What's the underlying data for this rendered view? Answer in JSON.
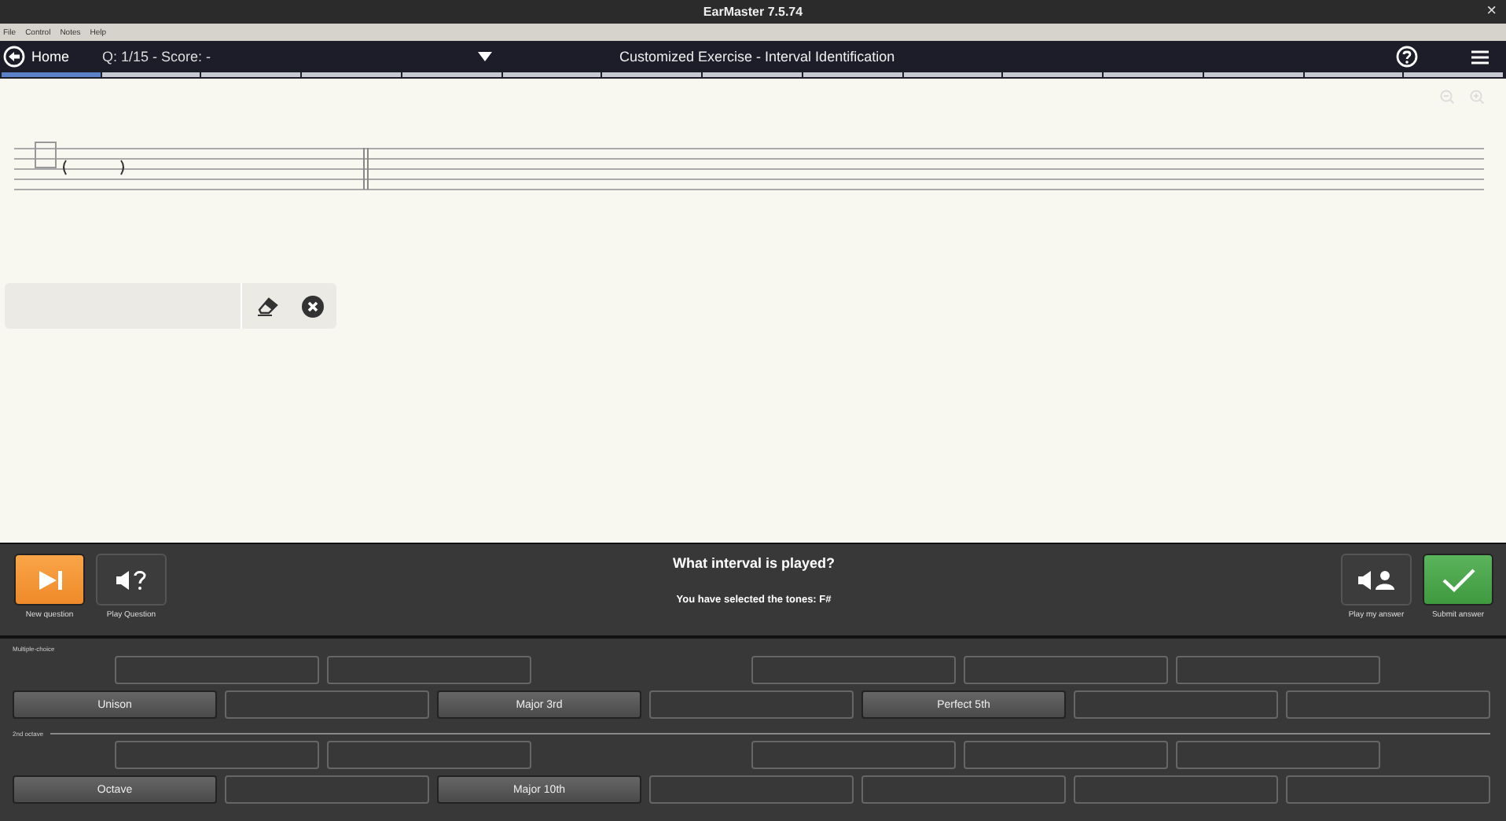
{
  "window": {
    "title": "EarMaster 7.5.74",
    "close": "×"
  },
  "menu": [
    "File",
    "Control",
    "Notes",
    "Help"
  ],
  "toolbar": {
    "home": "Home",
    "status": "Q: 1/15 - Score: -",
    "title": "Customized Exercise - Interval Identification"
  },
  "progress": [
    {
      "selected": true
    },
    {
      "selected": false
    },
    {
      "selected": false
    },
    {
      "selected": false
    },
    {
      "selected": false
    },
    {
      "selected": false
    },
    {
      "selected": false
    },
    {
      "selected": false
    },
    {
      "selected": false
    },
    {
      "selected": false
    },
    {
      "selected": false
    },
    {
      "selected": false
    },
    {
      "selected": false
    },
    {
      "selected": false
    },
    {
      "selected": false
    }
  ],
  "controls": {
    "left": [
      {
        "kind": "next",
        "label": "New question"
      },
      {
        "kind": "play",
        "label": "Play Question"
      }
    ],
    "question": "What interval is played?",
    "selection": "You have selected the tones: F#",
    "right": [
      {
        "kind": "play-answer",
        "label": "Play my answer"
      },
      {
        "kind": "submit",
        "label": "Submit answer"
      }
    ]
  },
  "sections": [
    {
      "label": "Multiple-choice",
      "divider": false,
      "top": [
        {
          "kind": "empty"
        },
        {
          "kind": "empty"
        },
        {
          "kind": "gap"
        },
        {
          "kind": "empty"
        },
        {
          "kind": "empty"
        },
        {
          "kind": "empty"
        }
      ],
      "bottom": [
        {
          "kind": "interval",
          "label": "Unison"
        },
        {
          "kind": "empty"
        },
        {
          "kind": "interval",
          "label": "Major 3rd"
        },
        {
          "kind": "empty"
        },
        {
          "kind": "interval",
          "label": "Perfect 5th"
        },
        {
          "kind": "empty"
        },
        {
          "kind": "empty"
        }
      ]
    },
    {
      "label": "2nd octave",
      "divider": true,
      "top": [
        {
          "kind": "empty"
        },
        {
          "kind": "empty"
        },
        {
          "kind": "gap"
        },
        {
          "kind": "empty"
        },
        {
          "kind": "empty"
        },
        {
          "kind": "empty"
        }
      ],
      "bottom": [
        {
          "kind": "interval",
          "label": "Octave"
        },
        {
          "kind": "empty"
        },
        {
          "kind": "interval",
          "label": "Major 10th"
        },
        {
          "kind": "empty"
        },
        {
          "kind": "empty"
        },
        {
          "kind": "empty"
        },
        {
          "kind": "empty"
        }
      ]
    }
  ]
}
